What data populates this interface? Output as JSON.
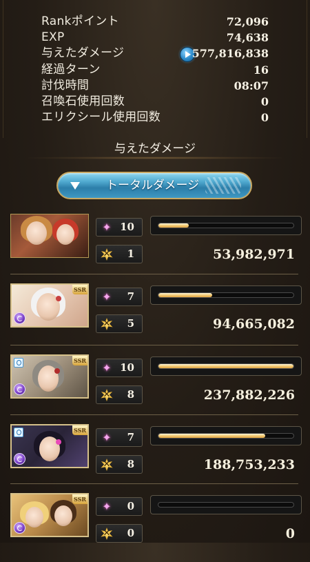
{
  "summary": {
    "rows": [
      {
        "label": "Rankポイント",
        "value": "72,096"
      },
      {
        "label": "EXP",
        "value": "74,638"
      },
      {
        "label": "与えたダメージ",
        "value": "577,816,838"
      },
      {
        "label": "経過ターン",
        "value": "16"
      },
      {
        "label": "討伐時間",
        "value": "08:07"
      },
      {
        "label": "召喚石使用回数",
        "value": "0"
      },
      {
        "label": "エリクシール使用回数",
        "value": "0"
      }
    ]
  },
  "section": {
    "title": "与えたダメージ"
  },
  "tab": {
    "label": "トータルダメージ"
  },
  "colors": {
    "accent_blue": "#4fa9cf",
    "bar_gold": "#f4cf7e",
    "star_pink": "#f5a6ee"
  },
  "characters": [
    {
      "name_icon": "character-portrait-1",
      "ssr": false,
      "element": "",
      "support": false,
      "charge_count": "10",
      "ougi_count": "1",
      "damage": "53,982,971",
      "damage_fraction": 0.227
    },
    {
      "name_icon": "character-portrait-2",
      "ssr": true,
      "element": "dark",
      "support": false,
      "charge_count": "7",
      "ougi_count": "5",
      "damage": "94,665,082",
      "damage_fraction": 0.398
    },
    {
      "name_icon": "character-portrait-3",
      "ssr": true,
      "element": "dark",
      "support": true,
      "charge_count": "10",
      "ougi_count": "8",
      "damage": "237,882,226",
      "damage_fraction": 1.0
    },
    {
      "name_icon": "character-portrait-4",
      "ssr": true,
      "element": "dark",
      "support": true,
      "charge_count": "7",
      "ougi_count": "8",
      "damage": "188,753,233",
      "damage_fraction": 0.793
    },
    {
      "name_icon": "character-portrait-5",
      "ssr": true,
      "element": "dark",
      "support": false,
      "charge_count": "0",
      "ougi_count": "0",
      "damage": "0",
      "damage_fraction": 0.0
    }
  ]
}
